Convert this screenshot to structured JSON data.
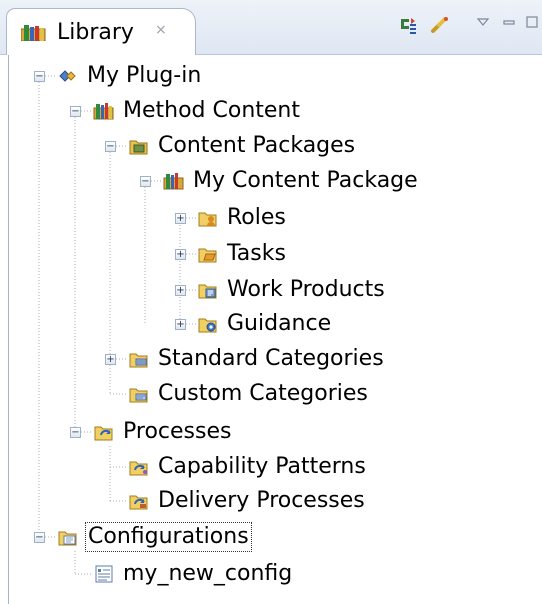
{
  "view": {
    "title": "Library",
    "close_glyph": "×",
    "toolbar": [
      {
        "name": "sync-icon"
      },
      {
        "name": "link-with-editor-icon"
      },
      {
        "name": "view-menu-icon"
      },
      {
        "name": "minimize-icon"
      },
      {
        "name": "maximize-icon"
      }
    ]
  },
  "tree": {
    "plugin": {
      "label": "My Plug-in",
      "expanded": true,
      "icon": "plugin-icon"
    },
    "method_content": {
      "label": "Method Content",
      "expanded": true,
      "icon": "method-content-icon"
    },
    "content_packages": {
      "label": "Content Packages",
      "expanded": true,
      "icon": "content-packages-icon"
    },
    "my_content_package": {
      "label": "My Content Package",
      "expanded": true,
      "icon": "content-package-icon"
    },
    "roles": {
      "label": "Roles",
      "expanded": false,
      "icon": "roles-folder-icon"
    },
    "tasks": {
      "label": "Tasks",
      "expanded": false,
      "icon": "tasks-folder-icon"
    },
    "work_products": {
      "label": "Work Products",
      "expanded": false,
      "icon": "work-products-folder-icon"
    },
    "guidance": {
      "label": "Guidance",
      "expanded": false,
      "icon": "guidance-folder-icon"
    },
    "standard_categories": {
      "label": "Standard Categories",
      "expanded": false,
      "icon": "standard-categories-icon"
    },
    "custom_categories": {
      "label": "Custom Categories",
      "icon": "custom-categories-icon"
    },
    "processes": {
      "label": "Processes",
      "expanded": true,
      "icon": "processes-icon"
    },
    "capability_patterns": {
      "label": "Capability Patterns",
      "icon": "capability-patterns-icon"
    },
    "delivery_processes": {
      "label": "Delivery Processes",
      "icon": "delivery-processes-icon"
    },
    "configurations": {
      "label": "Configurations",
      "expanded": true,
      "selected": true,
      "icon": "configurations-icon"
    },
    "my_new_config": {
      "label": "my_new_config",
      "icon": "configuration-icon"
    }
  }
}
